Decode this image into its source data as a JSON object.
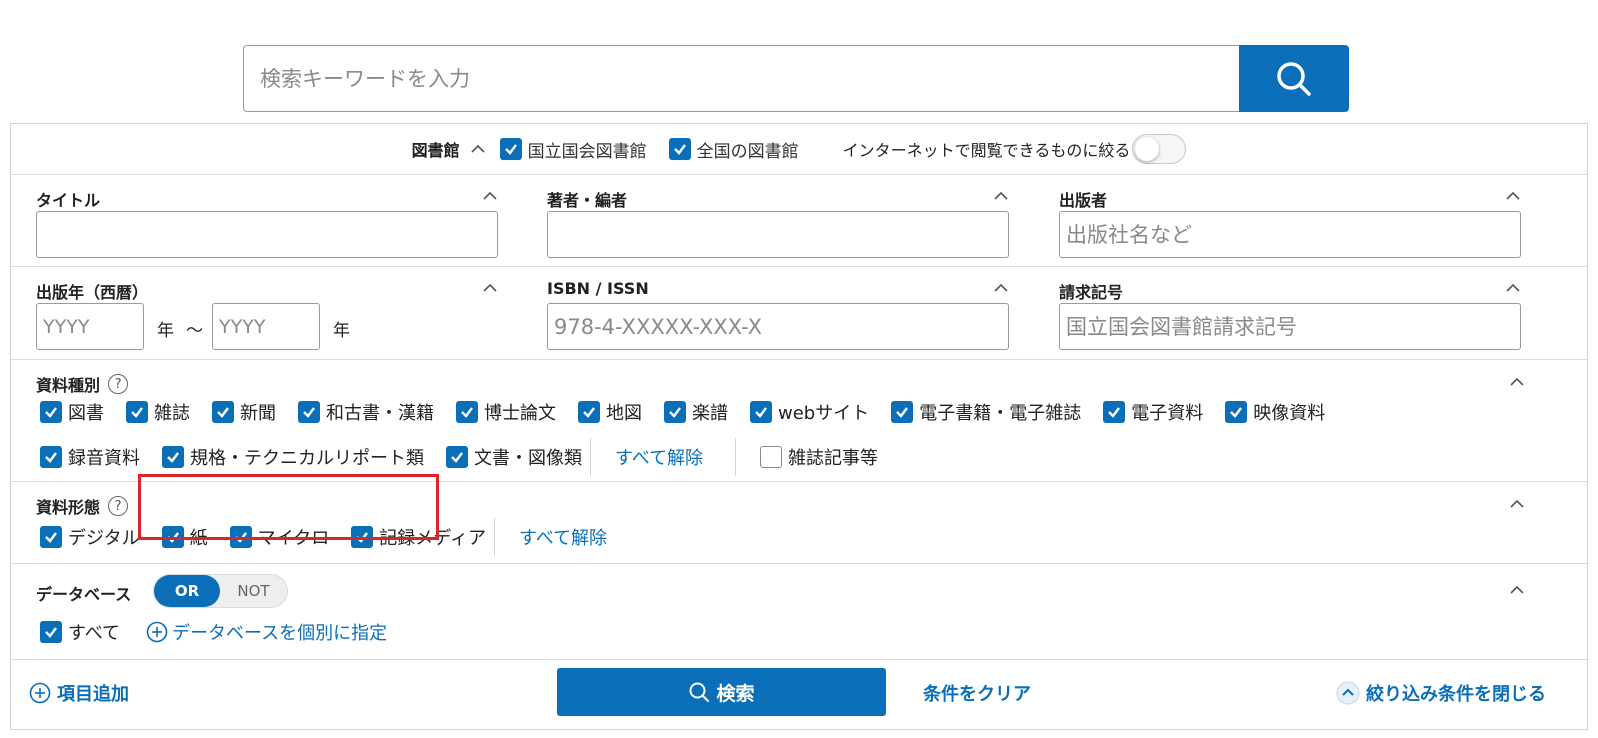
{
  "search": {
    "placeholder": "検索キーワードを入力"
  },
  "library": {
    "label": "図書館",
    "options": [
      {
        "label": "国立国会図書館",
        "checked": true
      },
      {
        "label": "全国の図書館",
        "checked": true
      }
    ],
    "internet_label": "インターネットで閲覧できるものに絞る",
    "internet_enabled": false
  },
  "fields": {
    "title": {
      "label": "タイトル",
      "placeholder": ""
    },
    "author": {
      "label": "著者・編者",
      "placeholder": ""
    },
    "publisher": {
      "label": "出版者",
      "placeholder": "出版社名など"
    },
    "year": {
      "label": "出版年（西暦）",
      "from_placeholder": "YYYY",
      "to_placeholder": "YYYY",
      "unit": "年",
      "range_sep": "〜"
    },
    "isbn": {
      "label": "ISBN / ISSN",
      "placeholder": "978-4-XXXXX-XXX-X"
    },
    "call_number": {
      "label": "請求記号",
      "placeholder": "国立国会図書館請求記号"
    }
  },
  "material_type": {
    "label": "資料種別",
    "help": "?",
    "row1": [
      {
        "label": "図書",
        "checked": true
      },
      {
        "label": "雑誌",
        "checked": true
      },
      {
        "label": "新聞",
        "checked": true
      },
      {
        "label": "和古書・漢籍",
        "checked": true
      },
      {
        "label": "博士論文",
        "checked": true
      },
      {
        "label": "地図",
        "checked": true
      },
      {
        "label": "楽譜",
        "checked": true
      },
      {
        "label": "webサイト",
        "checked": true
      },
      {
        "label": "電子書籍・電子雑誌",
        "checked": true
      },
      {
        "label": "電子資料",
        "checked": true
      },
      {
        "label": "映像資料",
        "checked": true
      }
    ],
    "row2": [
      {
        "label": "録音資料",
        "checked": true
      },
      {
        "label": "規格・テクニカルリポート類",
        "checked": true
      },
      {
        "label": "文書・図像類",
        "checked": true
      }
    ],
    "clear_all": "すべて解除",
    "articles": {
      "label": "雑誌記事等",
      "checked": false
    }
  },
  "material_form": {
    "label": "資料形態",
    "help": "?",
    "items": [
      {
        "label": "デジタル",
        "checked": true
      },
      {
        "label": "紙",
        "checked": true
      },
      {
        "label": "マイクロ",
        "checked": true
      },
      {
        "label": "記録メディア",
        "checked": true
      }
    ],
    "clear_all": "すべて解除"
  },
  "database": {
    "label": "データベース",
    "or_label": "OR",
    "not_label": "NOT",
    "all": {
      "label": "すべて",
      "checked": true
    },
    "specify": "データベースを個別に指定"
  },
  "footer": {
    "add_item": "項目追加",
    "search": "検索",
    "clear": "条件をクリア",
    "close": "絞り込み条件を閉じる"
  },
  "colors": {
    "accent": "#0a6fb8",
    "highlight": "#d9262b"
  }
}
